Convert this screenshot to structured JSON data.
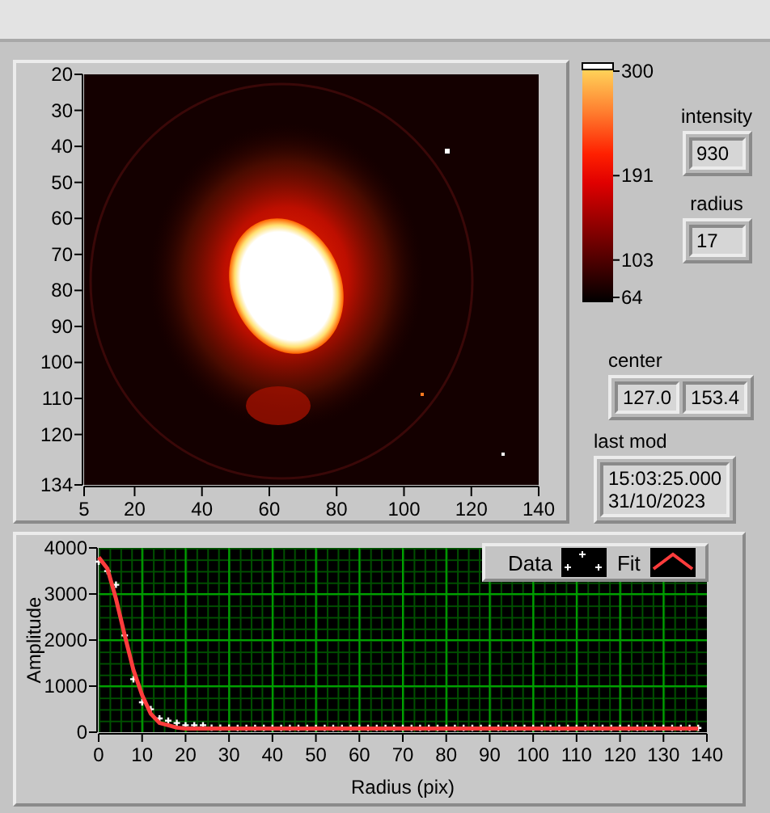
{
  "image_graph": {
    "y_ticks": [
      "20",
      "30",
      "40",
      "50",
      "60",
      "70",
      "80",
      "90",
      "100",
      "110",
      "120",
      "134"
    ],
    "x_ticks": [
      "5",
      "20",
      "40",
      "60",
      "80",
      "100",
      "120",
      "140"
    ]
  },
  "color_scale": {
    "ticks": [
      "300",
      "191",
      "103",
      "64"
    ]
  },
  "indicators": [
    {
      "label": "intensity",
      "values": [
        "930"
      ]
    },
    {
      "label": "radius",
      "values": [
        "17"
      ]
    },
    {
      "label": "center",
      "values": [
        "127.0",
        "153.4"
      ]
    },
    {
      "label": "last mod",
      "values": [
        "15:03:25.000\n31/10/2023"
      ]
    }
  ],
  "profile_graph": {
    "chart_data": {
      "type": "line",
      "xlabel": "Radius (pix)",
      "ylabel": "Amplitude",
      "grid": true,
      "xlim": [
        0,
        140
      ],
      "ylim": [
        0,
        4000
      ],
      "xticks": [
        0,
        10,
        20,
        30,
        40,
        50,
        60,
        70,
        80,
        90,
        100,
        110,
        120,
        130,
        140
      ],
      "yticks": [
        0,
        1000,
        2000,
        3000,
        4000
      ],
      "x": [
        0,
        2,
        4,
        6,
        8,
        10,
        12,
        14,
        16,
        18,
        20,
        22,
        24,
        26,
        28,
        30,
        32,
        34,
        36,
        38,
        40,
        42,
        44,
        46,
        48,
        50,
        52,
        54,
        56,
        58,
        60,
        62,
        64,
        66,
        68,
        70,
        72,
        74,
        76,
        78,
        80,
        82,
        84,
        86,
        88,
        90,
        92,
        94,
        96,
        98,
        100,
        102,
        104,
        106,
        108,
        110,
        112,
        114,
        116,
        118,
        120,
        122,
        124,
        126,
        128,
        130,
        132,
        134,
        136,
        138
      ],
      "series": [
        {
          "name": "Data",
          "color": "#ffffff",
          "values": [
            3700,
            3500,
            3200,
            2100,
            1150,
            650,
            500,
            300,
            250,
            200,
            150,
            150,
            150,
            100,
            100,
            100,
            90,
            90,
            90,
            90,
            90,
            90,
            90,
            90,
            90,
            90,
            90,
            90,
            90,
            90,
            90,
            90,
            90,
            90,
            90,
            90,
            90,
            90,
            90,
            90,
            90,
            90,
            90,
            90,
            90,
            90,
            90,
            90,
            90,
            90,
            90,
            90,
            90,
            90,
            90,
            90,
            90,
            90,
            90,
            90,
            90,
            90,
            90,
            90,
            90,
            90,
            90,
            90,
            90,
            90
          ]
        },
        {
          "name": "Fit",
          "color": "#ff3c3c",
          "values": [
            3800,
            3550,
            2900,
            2100,
            1350,
            800,
            400,
            200,
            150,
            100,
            80,
            80,
            80,
            80,
            80,
            80,
            80,
            80,
            80,
            80,
            80,
            80,
            80,
            80,
            80,
            80,
            80,
            80,
            80,
            80,
            80,
            80,
            80,
            80,
            80,
            80,
            80,
            80,
            80,
            80,
            80,
            80,
            80,
            80,
            80,
            80,
            80,
            80,
            80,
            80,
            80,
            80,
            80,
            80,
            80,
            80,
            80,
            80,
            80,
            80,
            80,
            80,
            80,
            80,
            80,
            80,
            80,
            80,
            80,
            80
          ]
        }
      ]
    }
  }
}
